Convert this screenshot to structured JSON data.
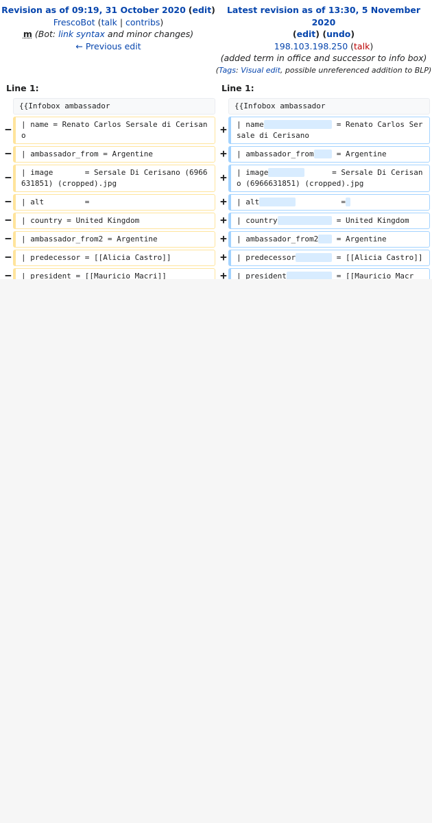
{
  "header": {
    "left": {
      "title": "Revision as of 09:19, 31 October 2020",
      "edit_label": "edit",
      "user": "FrescoBot",
      "talk_label": "talk",
      "contribs_label": "contribs",
      "minor_mark": "m",
      "summary_prefix": "(Bot: ",
      "summary_link": "link syntax",
      "summary_suffix": " and minor changes)",
      "prev_edit": "← Previous edit"
    },
    "right": {
      "title": "Latest revision as of 13:30, 5 November 2020",
      "edit_label": "edit",
      "undo_label": "undo",
      "user": "198.103.198.250",
      "talk_label": "talk",
      "summary": "(added term in office and successor to info box)",
      "tags_prefix": "(",
      "tags_label": "Tags",
      "tags_sep": ": ",
      "tag_visual_edit": "Visual edit",
      "tags_suffix": ", possible unreferenced addition to BLP)"
    }
  },
  "line_headers": {
    "left": "Line 1:",
    "right": "Line 1:"
  },
  "markers": {
    "del": "−",
    "add": "+"
  },
  "diff": {
    "context": {
      "left": "{{Infobox ambassador",
      "right": "{{Infobox ambassador"
    },
    "rows": [
      {
        "left": "| name = Renato Carlos Sersale di Cerisano",
        "right_before": "| name",
        "right_ins": "               ",
        "right_after": " = Renato Carlos Sersale di Cerisano"
      },
      {
        "left": "| ambassador_from = Argentine",
        "right_before": "| ambassador_from",
        "right_ins": "    ",
        "right_after": " = Argentine"
      },
      {
        "left": "| image       = Sersale Di Cerisano (6966631851) (cropped).jpg",
        "right_before": "| image",
        "right_ins": "        ",
        "right_after": "      = Sersale Di Cerisano (6966631851) (cropped).jpg"
      },
      {
        "left": "| alt         =",
        "right_before": "| alt",
        "right_ins": "        ",
        "right_after": "          =",
        "right_tail_ins": " "
      },
      {
        "left": "| country = United Kingdom",
        "right_before": "| country",
        "right_ins": "            ",
        "right_after": " = United Kingdom"
      },
      {
        "left": "| ambassador_from2 = Argentine",
        "right_before": "| ambassador_from2",
        "right_ins": "   ",
        "right_after": " = Argentine"
      },
      {
        "left": "| predecessor = [[Alicia Castro]]",
        "right_before": "| predecessor",
        "right_ins": "        ",
        "right_after": " = [[Alicia Castro]]"
      },
      {
        "left": "| president = [[Mauricio Macri]]",
        "right_before": "| president",
        "right_ins": "          ",
        "right_after": " = [[Mauricio Macri]]"
      }
    ]
  }
}
